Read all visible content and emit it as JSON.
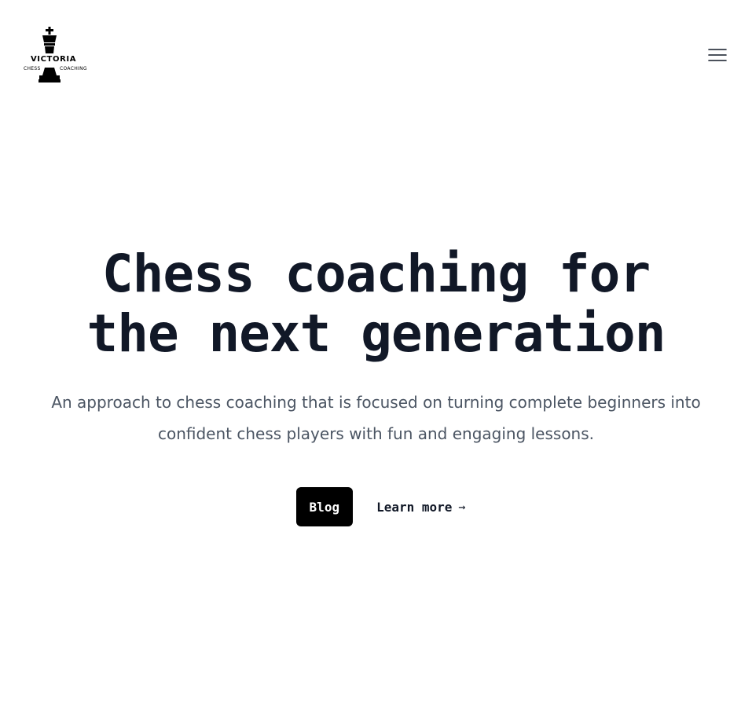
{
  "logo": {
    "name": "VICTORIA",
    "sub_left": "CHESS",
    "sub_right": "COACHING",
    "icon": "chess-king-icon"
  },
  "header": {
    "menu_icon": "hamburger-menu-icon"
  },
  "hero": {
    "title_line1": "Chess coaching for",
    "title_line2": "the next generation",
    "subtitle": "An approach to chess coaching that is focused on turning complete beginners into confident chess players with fun and engaging lessons."
  },
  "actions": {
    "blog_label": "Blog",
    "learn_more_label": "Learn more",
    "learn_more_arrow": "→"
  },
  "colors": {
    "heading": "#111827",
    "subtitle": "#4b5563",
    "primary_button_bg": "#000000",
    "primary_button_text": "#ffffff",
    "background": "#ffffff"
  }
}
